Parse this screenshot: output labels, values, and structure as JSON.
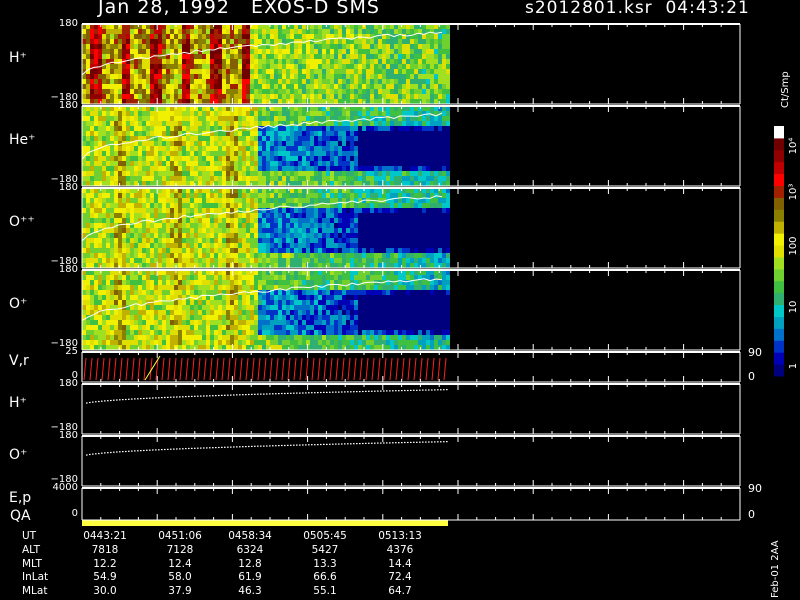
{
  "header": {
    "title": "Jan 28, 1992   EXOS-D SMS",
    "file_time": "s2012801.ksr  04:43:21"
  },
  "colorbar": {
    "unit": "Ct/Smp",
    "tick_labels": [
      "10⁴",
      "10³",
      "100",
      "10",
      "1"
    ],
    "colors": [
      "#00007f",
      "#0000b4",
      "#0032c8",
      "#0070c8",
      "#00a0c0",
      "#00c8c8",
      "#30b070",
      "#40c040",
      "#70d030",
      "#a0e020",
      "#e0e000",
      "#f0f000",
      "#c0b000",
      "#8a8000",
      "#806000",
      "#a02000",
      "#ff0000",
      "#c00000",
      "#900000",
      "#700000",
      "#ffffff"
    ]
  },
  "side_caption": "Feb-01 2AA",
  "panels": [
    {
      "label": "H⁺",
      "ymax": "180",
      "ymin": "−180",
      "kind": "spectrogram"
    },
    {
      "label": "He⁺",
      "ymax": "180",
      "ymin": "−180",
      "kind": "spectrogram"
    },
    {
      "label": "O⁺⁺",
      "ymax": "180",
      "ymin": "−180",
      "kind": "spectrogram"
    },
    {
      "label": "O⁺",
      "ymax": "180",
      "ymin": "−180",
      "kind": "spectrogram"
    },
    {
      "label": "V,r",
      "ymax": "25",
      "ymin": "0",
      "right_max": "90",
      "right_min": "0",
      "kind": "vr"
    },
    {
      "label": "H⁺",
      "ymax": "180",
      "ymin": "−180",
      "kind": "line"
    },
    {
      "label": "O⁺",
      "ymax": "180",
      "ymin": "−180",
      "kind": "line"
    },
    {
      "label": "E,p",
      "ymax": "4000",
      "ymin": "0",
      "right_max": "90",
      "right_min": "0",
      "kind": "ep"
    }
  ],
  "qa_label": "QA",
  "footer": {
    "rows": [
      {
        "name": "UT",
        "values": [
          "0443:21",
          "0451:06",
          "0458:34",
          "0505:45",
          "0513:13"
        ]
      },
      {
        "name": "ALT",
        "values": [
          "7818",
          "7128",
          "6324",
          "5427",
          "4376"
        ]
      },
      {
        "name": "MLT",
        "values": [
          "12.2",
          "12.4",
          "12.8",
          "13.3",
          "14.4"
        ]
      },
      {
        "name": "InLat",
        "values": [
          "54.9",
          "58.0",
          "61.9",
          "66.6",
          "72.4"
        ]
      },
      {
        "name": "MLat",
        "values": [
          "30.0",
          "37.9",
          "46.3",
          "55.1",
          "64.7"
        ]
      }
    ]
  },
  "chart_data": {
    "type": "heatmap",
    "title": "Jan 28, 1992   EXOS-D SMS",
    "x_tick_labels": [
      "0443:21",
      "0451:06",
      "0458:34",
      "0505:45",
      "0513:13"
    ],
    "series": [
      {
        "name": "H⁺",
        "ylim": [
          -180,
          180
        ]
      },
      {
        "name": "He⁺",
        "ylim": [
          -180,
          180
        ]
      },
      {
        "name": "O⁺⁺",
        "ylim": [
          -180,
          180
        ]
      },
      {
        "name": "O⁺",
        "ylim": [
          -180,
          180
        ]
      }
    ],
    "colorbar_label": "Ct/Smp",
    "colorbar_ticks": [
      "1",
      "10",
      "100",
      "10³",
      "10⁴"
    ]
  }
}
